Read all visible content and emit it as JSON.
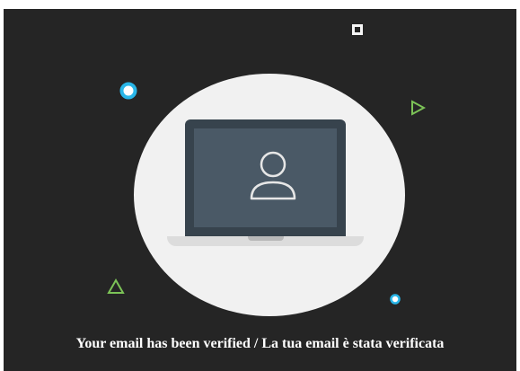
{
  "message": {
    "text": "Your email has been verified / La tua email è stata verificata"
  },
  "illustration": {
    "icon": "laptop-user-icon",
    "decorations": [
      "square-outline-icon",
      "ring-icon",
      "triangle-outline-icon",
      "triangle-outline-icon",
      "ring-icon"
    ]
  },
  "colors": {
    "background": "#252525",
    "circle": "#f1f1f1",
    "accent_cyan": "#29b6e8",
    "accent_green": "#7cc357",
    "laptop_frame": "#37434d"
  }
}
